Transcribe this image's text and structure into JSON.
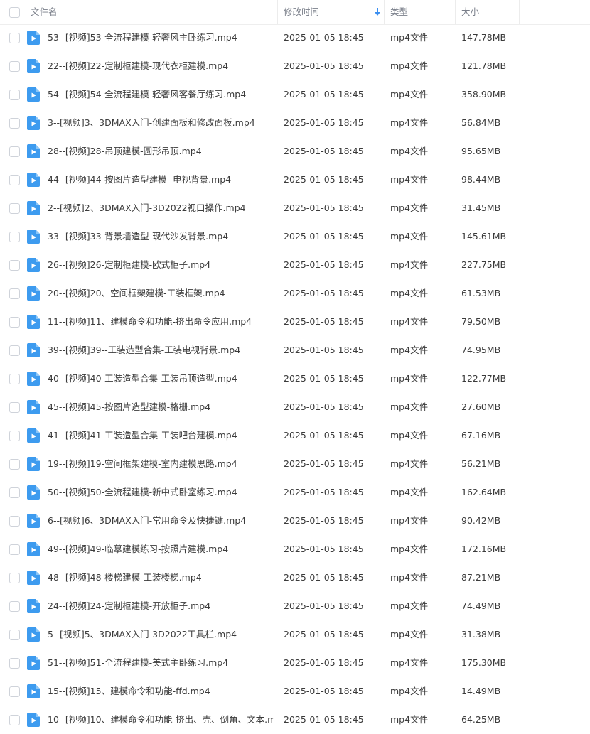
{
  "header": {
    "name": "文件名",
    "modified": "修改时间",
    "type": "类型",
    "size": "大小"
  },
  "colors": {
    "icon_blue": "#3d9bef",
    "sort_arrow": "#3a8ef0"
  },
  "icons": {
    "file": "video-file-icon",
    "sort": "sort-down-arrow-icon"
  },
  "files": [
    {
      "name": "53--[视频]53-全流程建模-轻奢风主卧练习.mp4",
      "modified": "2025-01-05 18:45",
      "type": "mp4文件",
      "size": "147.78MB"
    },
    {
      "name": "22--[视频]22-定制柜建模-现代衣柜建模.mp4",
      "modified": "2025-01-05 18:45",
      "type": "mp4文件",
      "size": "121.78MB"
    },
    {
      "name": "54--[视频]54-全流程建模-轻奢风客餐厅练习.mp4",
      "modified": "2025-01-05 18:45",
      "type": "mp4文件",
      "size": "358.90MB"
    },
    {
      "name": "3--[视频]3、3DMAX入门-创建面板和修改面板.mp4",
      "modified": "2025-01-05 18:45",
      "type": "mp4文件",
      "size": "56.84MB"
    },
    {
      "name": "28--[视频]28-吊顶建模-圆形吊顶.mp4",
      "modified": "2025-01-05 18:45",
      "type": "mp4文件",
      "size": "95.65MB"
    },
    {
      "name": "44--[视频]44-按图片造型建模- 电视背景.mp4",
      "modified": "2025-01-05 18:45",
      "type": "mp4文件",
      "size": "98.44MB"
    },
    {
      "name": "2--[视频]2、3DMAX入门-3D2022视口操作.mp4",
      "modified": "2025-01-05 18:45",
      "type": "mp4文件",
      "size": "31.45MB"
    },
    {
      "name": "33--[视频]33-背景墙造型-现代沙发背景.mp4",
      "modified": "2025-01-05 18:45",
      "type": "mp4文件",
      "size": "145.61MB"
    },
    {
      "name": "26--[视频]26-定制柜建模-欧式柜子.mp4",
      "modified": "2025-01-05 18:45",
      "type": "mp4文件",
      "size": "227.75MB"
    },
    {
      "name": "20--[视频]20、空间框架建模-工装框架.mp4",
      "modified": "2025-01-05 18:45",
      "type": "mp4文件",
      "size": "61.53MB"
    },
    {
      "name": "11--[视频]11、建模命令和功能-挤出命令应用.mp4",
      "modified": "2025-01-05 18:45",
      "type": "mp4文件",
      "size": "79.50MB"
    },
    {
      "name": "39--[视频]39--工装造型合集-工装电视背景.mp4",
      "modified": "2025-01-05 18:45",
      "type": "mp4文件",
      "size": "74.95MB"
    },
    {
      "name": "40--[视频]40-工装造型合集-工装吊顶造型.mp4",
      "modified": "2025-01-05 18:45",
      "type": "mp4文件",
      "size": "122.77MB"
    },
    {
      "name": "45--[视频]45-按图片造型建模-格栅.mp4",
      "modified": "2025-01-05 18:45",
      "type": "mp4文件",
      "size": "27.60MB"
    },
    {
      "name": "41--[视频]41-工装造型合集-工装吧台建模.mp4",
      "modified": "2025-01-05 18:45",
      "type": "mp4文件",
      "size": "67.16MB"
    },
    {
      "name": "19--[视频]19-空间框架建模-室内建模思路.mp4",
      "modified": "2025-01-05 18:45",
      "type": "mp4文件",
      "size": "56.21MB"
    },
    {
      "name": "50--[视频]50-全流程建模-新中式卧室练习.mp4",
      "modified": "2025-01-05 18:45",
      "type": "mp4文件",
      "size": "162.64MB"
    },
    {
      "name": "6--[视频]6、3DMAX入门-常用命令及快捷键.mp4",
      "modified": "2025-01-05 18:45",
      "type": "mp4文件",
      "size": "90.42MB"
    },
    {
      "name": "49--[视频]49-临摹建模练习-按照片建模.mp4",
      "modified": "2025-01-05 18:45",
      "type": "mp4文件",
      "size": "172.16MB"
    },
    {
      "name": "48--[视频]48-楼梯建模-工装楼梯.mp4",
      "modified": "2025-01-05 18:45",
      "type": "mp4文件",
      "size": "87.21MB"
    },
    {
      "name": "24--[视频]24-定制柜建模-开放柜子.mp4",
      "modified": "2025-01-05 18:45",
      "type": "mp4文件",
      "size": "74.49MB"
    },
    {
      "name": "5--[视频]5、3DMAX入门-3D2022工具栏.mp4",
      "modified": "2025-01-05 18:45",
      "type": "mp4文件",
      "size": "31.38MB"
    },
    {
      "name": "51--[视频]51-全流程建模-美式主卧练习.mp4",
      "modified": "2025-01-05 18:45",
      "type": "mp4文件",
      "size": "175.30MB"
    },
    {
      "name": "15--[视频]15、建模命令和功能-ffd.mp4",
      "modified": "2025-01-05 18:45",
      "type": "mp4文件",
      "size": "14.49MB"
    },
    {
      "name": "10--[视频]10、建模命令和功能-挤出、壳、倒角、文本.m",
      "modified": "2025-01-05 18:45",
      "type": "mp4文件",
      "size": "64.25MB"
    }
  ]
}
